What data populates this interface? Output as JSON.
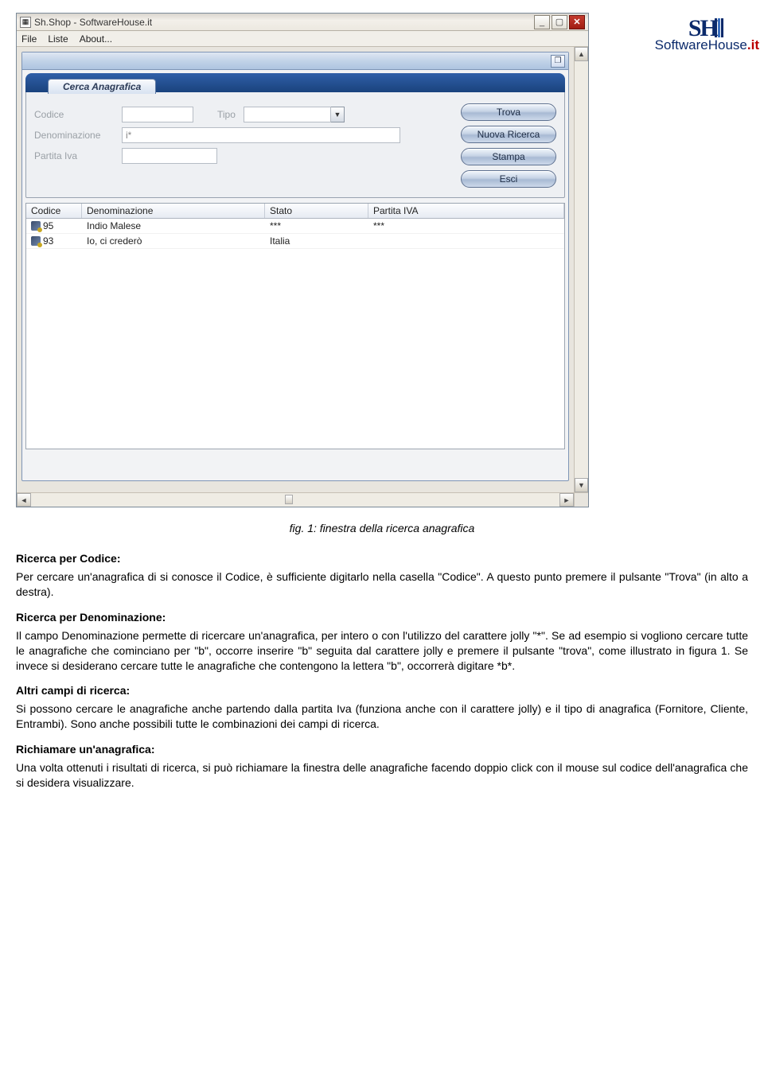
{
  "logo": {
    "brand_prefix": "SoftwareHouse",
    "brand_suffix": ".it"
  },
  "window": {
    "title": "Sh.Shop - SoftwareHouse.it",
    "menu": {
      "file": "File",
      "liste": "Liste",
      "about": "About..."
    }
  },
  "child": {
    "panel_title": "Cerca Anagrafica",
    "labels": {
      "codice": "Codice",
      "tipo": "Tipo",
      "denominazione": "Denominazione",
      "partita_iva": "Partita Iva"
    },
    "values": {
      "codice": "",
      "tipo": "",
      "denominazione": "i*",
      "partita_iva": ""
    },
    "buttons": {
      "trova": "Trova",
      "nuova_ricerca": "Nuova Ricerca",
      "stampa": "Stampa",
      "esci": "Esci"
    },
    "grid": {
      "headers": {
        "codice": "Codice",
        "denominazione": "Denominazione",
        "stato": "Stato",
        "partita_iva": "Partita IVA"
      },
      "rows": [
        {
          "codice": "95",
          "denominazione": "Indio Malese",
          "stato": "***",
          "piva": "***"
        },
        {
          "codice": "93",
          "denominazione": "Io, ci crederò",
          "stato": "Italia",
          "piva": ""
        }
      ]
    }
  },
  "doc": {
    "caption": "fig. 1: finestra della ricerca anagrafica",
    "sections": {
      "ricerca_codice_h": "Ricerca per Codice:",
      "ricerca_codice_p": "Per cercare un'anagrafica di si conosce il Codice, è sufficiente digitarlo nella casella \"Codice\". A questo punto premere il pulsante \"Trova\" (in alto a destra).",
      "ricerca_denom_h": "Ricerca per Denominazione:",
      "ricerca_denom_p": "Il campo Denominazione permette di ricercare un'anagrafica, per intero o con l'utilizzo del carattere jolly \"*\". Se ad esempio si vogliono cercare tutte le anagrafiche che cominciano per \"b\", occorre inserire \"b\" seguita dal carattere jolly e premere il pulsante \"trova\", come illustrato in figura 1. Se invece si desiderano cercare tutte le anagrafiche che contengono la lettera \"b\", occorrerà digitare *b*.",
      "altri_h": "Altri campi di ricerca:",
      "altri_p": "Si possono cercare le anagrafiche anche partendo dalla partita Iva (funziona anche con il carattere jolly) e il tipo di anagrafica (Fornitore, Cliente, Entrambi). Sono anche possibili tutte le combinazioni dei campi di ricerca.",
      "richiama_h": "Richiamare un'anagrafica:",
      "richiama_p": "Una volta ottenuti i risultati di ricerca, si può richiamare la finestra delle anagrafiche facendo doppio click con il mouse sul codice dell'anagrafica che si desidera visualizzare."
    }
  }
}
